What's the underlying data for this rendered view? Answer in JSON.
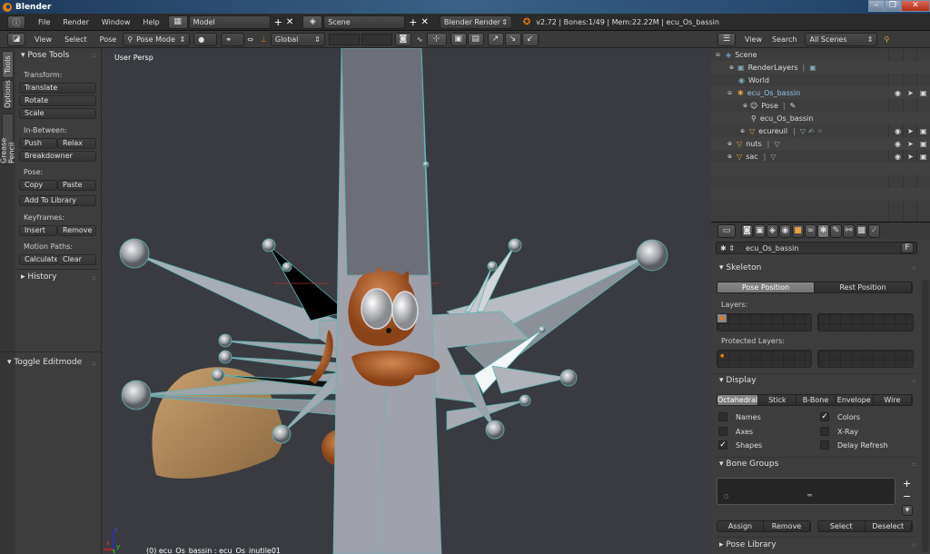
{
  "window": {
    "title": "Blender"
  },
  "infobar": {
    "menus": [
      "File",
      "Render",
      "Window",
      "Help"
    ],
    "screen_layout": "Model",
    "scene": "Scene",
    "render_engine": "Blender Render",
    "stats": "v2.72 | Bones:1/49  | Mem:22.22M | ecu_Os_bassin"
  },
  "view3d_header": {
    "menus": [
      "View",
      "Select",
      "Pose"
    ],
    "mode": "Pose Mode",
    "orientation": "Global"
  },
  "toolshelf": {
    "tabs": [
      "Tools",
      "Options",
      "Grease Pencil"
    ],
    "panel_title": "Pose Tools",
    "transform_label": "Transform:",
    "translate": "Translate",
    "rotate": "Rotate",
    "scale": "Scale",
    "inbetween_label": "In-Between:",
    "push": "Push",
    "relax": "Relax",
    "breakdowner": "Breakdowner",
    "pose_label": "Pose:",
    "copy": "Copy",
    "paste": "Paste",
    "add_to_library": "Add To Library",
    "keyframes_label": "Keyframes:",
    "insert": "Insert",
    "remove": "Remove",
    "motion_paths_label": "Motion Paths:",
    "calculate": "Calculate",
    "clear": "Clear",
    "history": "History",
    "operator_panel": "Toggle Editmode"
  },
  "viewport": {
    "view_name": "User Persp",
    "status": "(0) ecu_Os_bassin : ecu_Os_inutile01",
    "axis_x": "x",
    "axis_y": "y",
    "axis_z": "z"
  },
  "outliner": {
    "menus": [
      "View",
      "Search"
    ],
    "display_mode": "All Scenes",
    "items": [
      {
        "name": "Scene",
        "type": "scene"
      },
      {
        "name": "RenderLayers",
        "type": "renderlayers"
      },
      {
        "name": "World",
        "type": "world"
      },
      {
        "name": "ecu_Os_bassin",
        "type": "armature",
        "selected": true
      },
      {
        "name": "Pose",
        "type": "pose"
      },
      {
        "name": "ecu_Os_bassin",
        "type": "armature-data"
      },
      {
        "name": "ecureuil",
        "type": "mesh"
      },
      {
        "name": "nuts",
        "type": "mesh"
      },
      {
        "name": "sac",
        "type": "mesh"
      }
    ]
  },
  "properties": {
    "datablock_name": "ecu_Os_bassin",
    "fake_user": "F",
    "skeleton": {
      "title": "Skeleton",
      "pose_position": "Pose Position",
      "rest_position": "Rest Position",
      "layers_label": "Layers:",
      "protected_layers_label": "Protected Layers:"
    },
    "display": {
      "title": "Display",
      "types": [
        "Octahedral",
        "Stick",
        "B-Bone",
        "Envelope",
        "Wire"
      ],
      "active_type": "Octahedral",
      "options": [
        {
          "label": "Names",
          "checked": false
        },
        {
          "label": "Colors",
          "checked": true
        },
        {
          "label": "Axes",
          "checked": false
        },
        {
          "label": "X-Ray",
          "checked": false
        },
        {
          "label": "Shapes",
          "checked": true
        },
        {
          "label": "Delay Refresh",
          "checked": false
        }
      ]
    },
    "bone_groups": {
      "title": "Bone Groups",
      "assign": "Assign",
      "remove": "Remove",
      "select": "Select",
      "deselect": "Deselect"
    },
    "pose_library": {
      "title": "Pose Library"
    }
  }
}
